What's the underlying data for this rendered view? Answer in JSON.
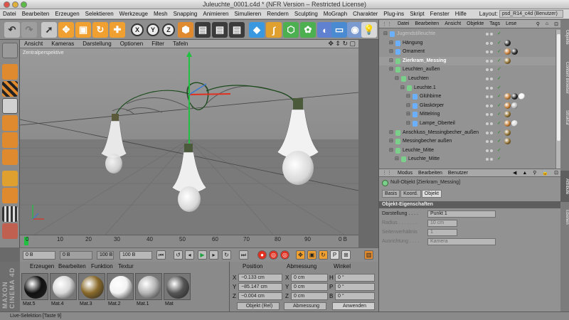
{
  "window": {
    "title": "Juleuchte_0001.c4d * (NFR Version – Restricted License)"
  },
  "menubar": {
    "items": [
      "Datei",
      "Bearbeiten",
      "Erzeugen",
      "Selektieren",
      "Werkzeuge",
      "Mesh",
      "Snapping",
      "Animieren",
      "Simulieren",
      "Rendern",
      "Sculpting",
      "MoGraph",
      "Charakter",
      "Plug-ins",
      "Skript",
      "Fenster",
      "Hilfe"
    ],
    "layout_label": "Layout:",
    "layout_value": "psd_R14_c4d (Benutzer)"
  },
  "viewport": {
    "menu": [
      "Ansicht",
      "Kameras",
      "Darstellung",
      "Optionen",
      "Filter",
      "Tafeln"
    ],
    "label": "Zentralperspektive"
  },
  "timeline": {
    "ticks": [
      "0",
      "10",
      "20",
      "30",
      "40",
      "50",
      "60",
      "70",
      "80",
      "90"
    ],
    "end_label": "0 B"
  },
  "transport": {
    "start": "0 B",
    "current": "0 B",
    "end": "100 B",
    "end2": "100 B"
  },
  "materials": {
    "tabs": [
      "Erzeugen",
      "Bearbeiten",
      "Funktion",
      "Textur"
    ],
    "items": [
      {
        "label": "Mat.5",
        "color": "#111111"
      },
      {
        "label": "Mat.4",
        "color": "#d8d8d8"
      },
      {
        "label": "Mat.3",
        "color": "#8a6a2a"
      },
      {
        "label": "Mat.2",
        "color": "#f2f2f2"
      },
      {
        "label": "Mat.1",
        "color": "#b5b5b5"
      },
      {
        "label": "Mat",
        "color": "#555555"
      }
    ]
  },
  "coords": {
    "headers": [
      "Position",
      "Abmessung",
      "Winkel"
    ],
    "rows": [
      {
        "axis": "X",
        "pos": "−0.133 cm",
        "size_axis": "X",
        "size": "0 cm",
        "rot_axis": "H",
        "rot": "0 °"
      },
      {
        "axis": "Y",
        "pos": "−85.147 cm",
        "size_axis": "Y",
        "size": "0 cm",
        "rot_axis": "P",
        "rot": "0 °"
      },
      {
        "axis": "Z",
        "pos": "−0.004 cm",
        "size_axis": "Z",
        "size": "0 cm",
        "rot_axis": "B",
        "rot": "0 °"
      }
    ],
    "mode1": "Objekt (Rel)",
    "mode2": "Abmessung",
    "apply": "Anwenden"
  },
  "object_manager": {
    "menu": [
      "Datei",
      "Bearbeiten",
      "Ansicht",
      "Objekte",
      "Tags",
      "Lese"
    ],
    "rows": [
      {
        "name": "Jugendstilleuchte",
        "indent": 0,
        "color": "#6ab0ff",
        "tags": [],
        "faded": true
      },
      {
        "name": "Hängung",
        "indent": 1,
        "color": "#6ab0ff",
        "tags": [
          "#222222"
        ],
        "faded": false
      },
      {
        "name": "Ornament",
        "indent": 1,
        "color": "#6ab0ff",
        "tags": [
          "#c07830",
          "#222222"
        ],
        "faded": false
      },
      {
        "name": "Zierkram_Messing",
        "indent": 1,
        "color": "#7ad08a",
        "tags": [
          "#8a6a2a"
        ],
        "faded": false,
        "selected": true
      },
      {
        "name": "Leuchten_außen",
        "indent": 1,
        "color": "#7ad08a",
        "tags": [],
        "faded": false
      },
      {
        "name": "Leuchten",
        "indent": 2,
        "color": "#7ad08a",
        "tags": [],
        "faded": false
      },
      {
        "name": "Leuchte.1",
        "indent": 3,
        "color": "#7ad08a",
        "tags": [],
        "faded": false
      },
      {
        "name": "Glühbirne",
        "indent": 4,
        "color": "#6ab0ff",
        "tags": [
          "#c07830",
          "#222222",
          "#f2f2f2"
        ],
        "faded": false
      },
      {
        "name": "Glaskörper",
        "indent": 4,
        "color": "#6ab0ff",
        "tags": [
          "#c07830",
          "#b5b5b5"
        ],
        "faded": false
      },
      {
        "name": "Mittelring",
        "indent": 4,
        "color": "#6ab0ff",
        "tags": [
          "#8a6a2a"
        ],
        "faded": false
      },
      {
        "name": "Lampe_Oberteil",
        "indent": 4,
        "color": "#6ab0ff",
        "tags": [
          "#c07830",
          "#d8d8d8"
        ],
        "faded": false
      },
      {
        "name": "Anschluss_Messingbecher_außen",
        "indent": 1,
        "color": "#7ad08a",
        "tags": [
          "#8a6a2a"
        ],
        "faded": false
      },
      {
        "name": "Messingbecher außen",
        "indent": 1,
        "color": "#7ad08a",
        "tags": [
          "#8a6a2a"
        ],
        "faded": false
      },
      {
        "name": "Leuchte_Mitte",
        "indent": 1,
        "color": "#7ad08a",
        "tags": [],
        "faded": false
      },
      {
        "name": "Leuchte_Mitte",
        "indent": 2,
        "color": "#7ad08a",
        "tags": [],
        "faded": false
      }
    ]
  },
  "attributes": {
    "menu": [
      "Modus",
      "Bearbeiten",
      "Benutzer"
    ],
    "object_label": "Null-Objekt [Zierkram_Messing]",
    "tabs": [
      "Basis",
      "Koord.",
      "Objekt"
    ],
    "active_tab": "Objekt",
    "section": "Objekt-Eigenschaften",
    "rows": [
      {
        "label": "Darstellung . . . .",
        "value": "Punkt 1",
        "disabled": false
      },
      {
        "label": "Radius . . . . . . .",
        "value": "10 cm",
        "disabled": true
      },
      {
        "label": "Seitenverhältnis",
        "value": "1",
        "disabled": true
      },
      {
        "label": "Ausrichtung . . . .",
        "value": "Kamera",
        "disabled": true
      }
    ]
  },
  "sidetabs": [
    "Objekte",
    "Content Browser",
    "Struktur",
    "Attribute",
    "Ebenen"
  ],
  "status": "Live-Selektion [Taste 9]",
  "colors": {
    "accent_red": "#e03020",
    "accent_yellow": "#f0a030",
    "accent_blue": "#3a78d0",
    "green_axis": "#20c040"
  }
}
